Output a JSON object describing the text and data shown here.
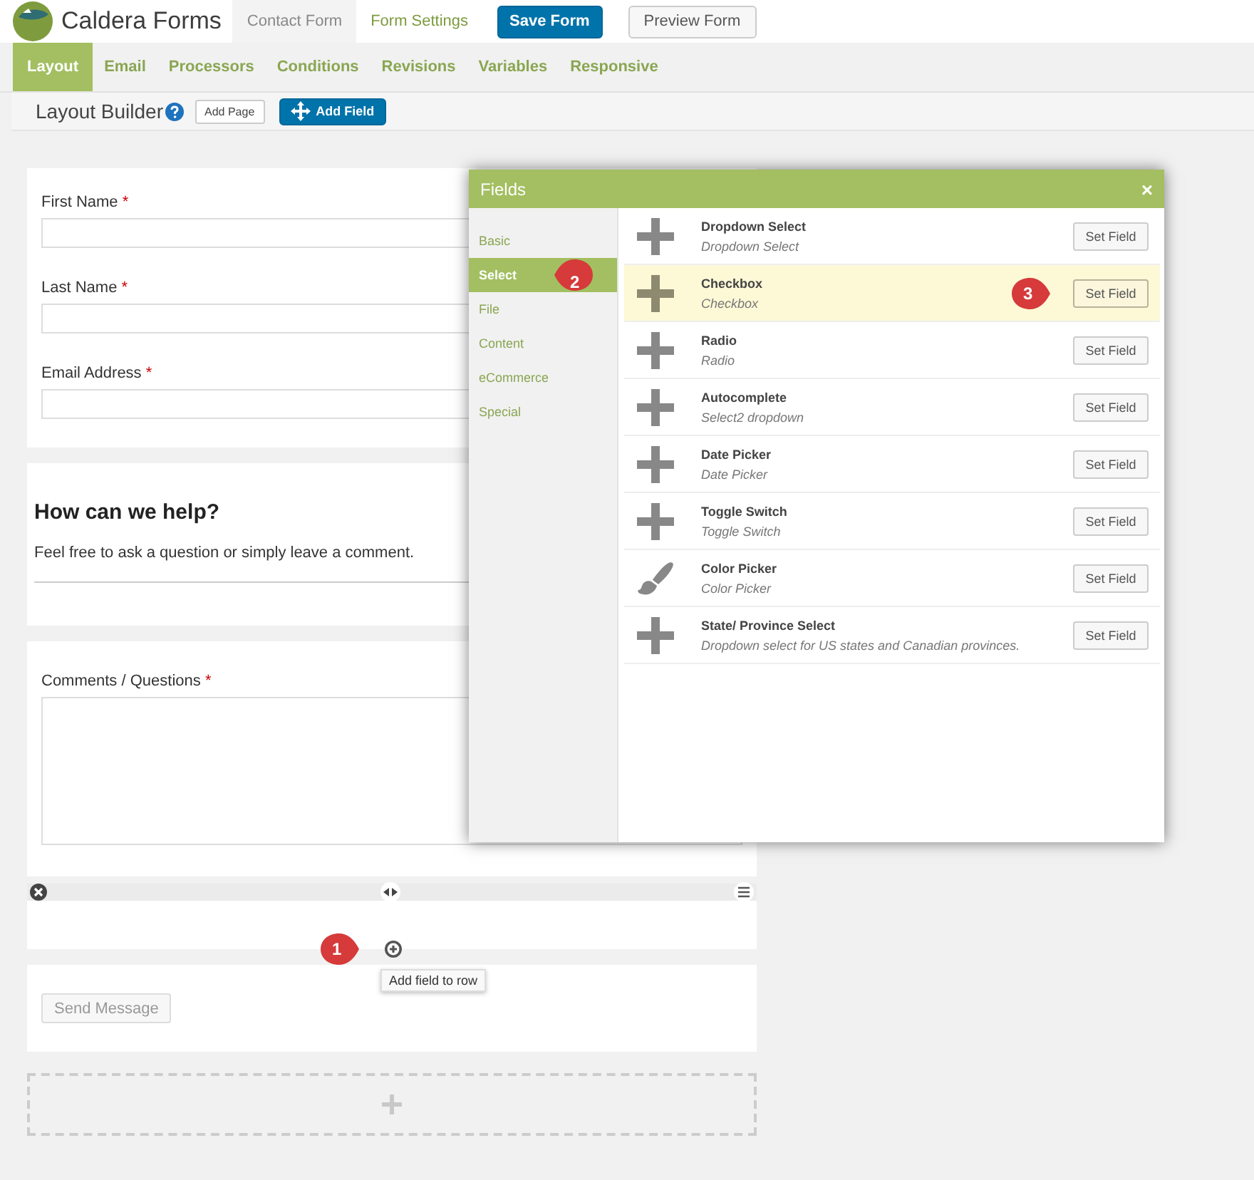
{
  "header": {
    "brand": "Caldera Forms",
    "tabs": [
      {
        "label": "Contact Form",
        "selected": true
      },
      {
        "label": "Form Settings",
        "selected": false
      }
    ],
    "save_button": "Save Form",
    "preview_button": "Preview Form"
  },
  "nav_tabs": [
    {
      "label": "Layout",
      "selected": true
    },
    {
      "label": "Email",
      "selected": false
    },
    {
      "label": "Processors",
      "selected": false
    },
    {
      "label": "Conditions",
      "selected": false
    },
    {
      "label": "Revisions",
      "selected": false
    },
    {
      "label": "Variables",
      "selected": false
    },
    {
      "label": "Responsive",
      "selected": false
    }
  ],
  "toolbar": {
    "title": "Layout Builder",
    "add_page": "Add Page",
    "add_field": "Add Field"
  },
  "form_rows": [
    {
      "kind": "fields",
      "fields": [
        {
          "label": "First Name",
          "required_mark": "*"
        },
        {
          "label": "Last Name",
          "required_mark": "*"
        },
        {
          "label": "Email Address",
          "required_mark": "*"
        }
      ]
    },
    {
      "kind": "text",
      "heading": "How can we help?",
      "paragraph": "Feel free to ask a question or simply leave a comment."
    },
    {
      "kind": "textarea",
      "label": "Comments / Questions",
      "required_mark": "*"
    },
    {
      "kind": "empty",
      "tooltip": "Add field to row",
      "callout": "1"
    },
    {
      "kind": "button",
      "label": "Send Message"
    },
    {
      "kind": "new_row"
    }
  ],
  "modal": {
    "title": "Fields",
    "close": "×",
    "categories": [
      {
        "label": "Basic",
        "selected": false
      },
      {
        "label": "Select",
        "selected": true,
        "callout": "2"
      },
      {
        "label": "File",
        "selected": false
      },
      {
        "label": "Content",
        "selected": false
      },
      {
        "label": "eCommerce",
        "selected": false
      },
      {
        "label": "Special",
        "selected": false
      }
    ],
    "items": [
      {
        "kind": "plus",
        "name": "Dropdown Select",
        "description": "Dropdown Select",
        "highlighted": false,
        "button": "Set Field"
      },
      {
        "kind": "plus",
        "name": "Checkbox",
        "description": "Checkbox",
        "highlighted": true,
        "button": "Set Field",
        "callout": "3"
      },
      {
        "kind": "plus",
        "name": "Radio",
        "description": "Radio",
        "highlighted": false,
        "button": "Set Field"
      },
      {
        "kind": "plus",
        "name": "Autocomplete",
        "description": "Select2 dropdown",
        "highlighted": false,
        "button": "Set Field"
      },
      {
        "kind": "plus",
        "name": "Date Picker",
        "description": "Date Picker",
        "highlighted": false,
        "button": "Set Field"
      },
      {
        "kind": "plus",
        "name": "Toggle Switch",
        "description": "Toggle Switch",
        "highlighted": false,
        "button": "Set Field"
      },
      {
        "kind": "brush",
        "name": "Color Picker",
        "description": "Color Picker",
        "highlighted": false,
        "button": "Set Field"
      },
      {
        "kind": "plus",
        "name": "State/ Province Select",
        "description": "Dropdown select for US states and Canadian provinces.",
        "highlighted": false,
        "button": "Set Field"
      }
    ]
  }
}
